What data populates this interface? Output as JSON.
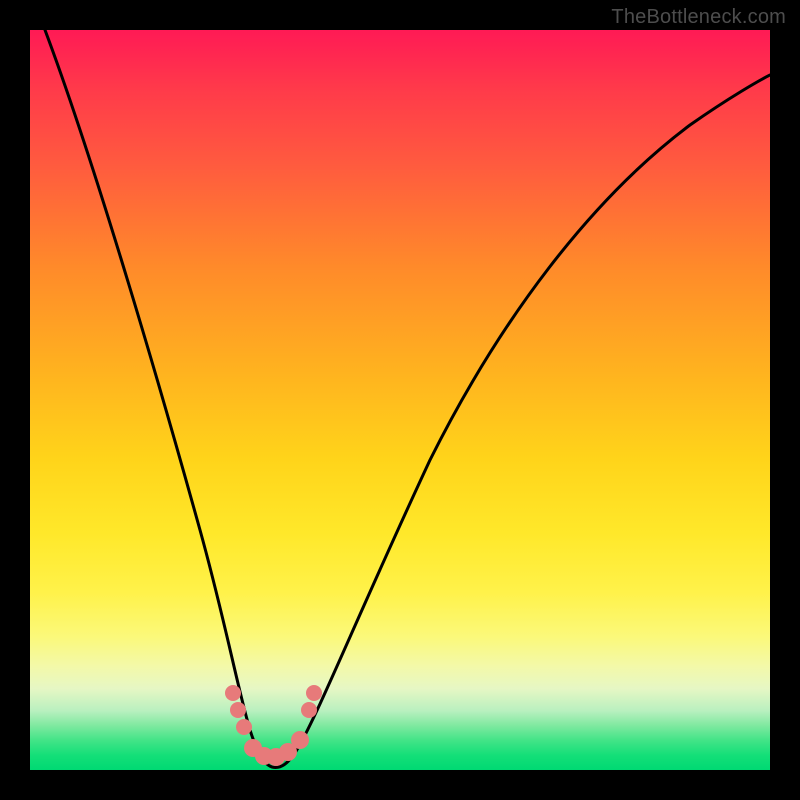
{
  "watermark": "TheBottleneck.com",
  "chart_data": {
    "type": "line",
    "title": "",
    "xlabel": "",
    "ylabel": "",
    "xlim": [
      0,
      100
    ],
    "ylim": [
      0,
      100
    ],
    "series": [
      {
        "name": "bottleneck-curve",
        "x": [
          2,
          8,
          14,
          18,
          22,
          25,
          27,
          29,
          31,
          33,
          35,
          38,
          42,
          48,
          56,
          66,
          78,
          90,
          100
        ],
        "values": [
          100,
          80,
          60,
          45,
          30,
          18,
          10,
          4,
          1,
          0,
          1,
          4,
          12,
          24,
          40,
          56,
          70,
          80,
          86
        ]
      }
    ],
    "markers": {
      "name": "highlight-dots",
      "x": [
        26,
        27,
        28,
        30,
        32,
        34,
        36,
        37
      ],
      "values": [
        10,
        7,
        4,
        1,
        1,
        3,
        7,
        10
      ],
      "color": "#e77a7a"
    },
    "gradient_stops": [
      {
        "pos": 0,
        "color": "#ff1a55"
      },
      {
        "pos": 50,
        "color": "#ffd41a"
      },
      {
        "pos": 90,
        "color": "#e6f7c4"
      },
      {
        "pos": 100,
        "color": "#00d973"
      }
    ]
  }
}
